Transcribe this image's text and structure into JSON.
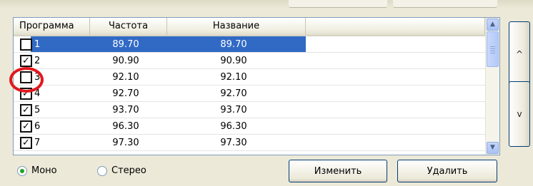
{
  "list": {
    "columns": [
      {
        "label": "Программа"
      },
      {
        "label": "Частота"
      },
      {
        "label": "Название"
      },
      {
        "label": ""
      }
    ],
    "rows": [
      {
        "program": "1",
        "checked": false,
        "frequency": "89.70",
        "name": "89.70",
        "selected": true
      },
      {
        "program": "2",
        "checked": true,
        "frequency": "90.90",
        "name": "90.90",
        "selected": false
      },
      {
        "program": "3",
        "checked": false,
        "frequency": "92.10",
        "name": "92.10",
        "selected": false
      },
      {
        "program": "4",
        "checked": true,
        "frequency": "92.70",
        "name": "92.70",
        "selected": false
      },
      {
        "program": "5",
        "checked": true,
        "frequency": "93.70",
        "name": "93.70",
        "selected": false
      },
      {
        "program": "6",
        "checked": true,
        "frequency": "96.30",
        "name": "96.30",
        "selected": false
      },
      {
        "program": "7",
        "checked": true,
        "frequency": "97.30",
        "name": "97.30",
        "selected": false
      }
    ],
    "scrollbar": {
      "up_icon": "triangle-up",
      "down_icon": "triangle-down"
    }
  },
  "side_buttons": {
    "up_label": "^",
    "down_label": "v"
  },
  "mode": {
    "mono_label": "Моно",
    "stereo_label": "Стерео",
    "selected": "mono"
  },
  "actions": {
    "edit_label": "Изменить",
    "delete_label": "Удалить"
  },
  "colors": {
    "selection": "#316ac5",
    "highlight_circle": "#e2181c"
  }
}
